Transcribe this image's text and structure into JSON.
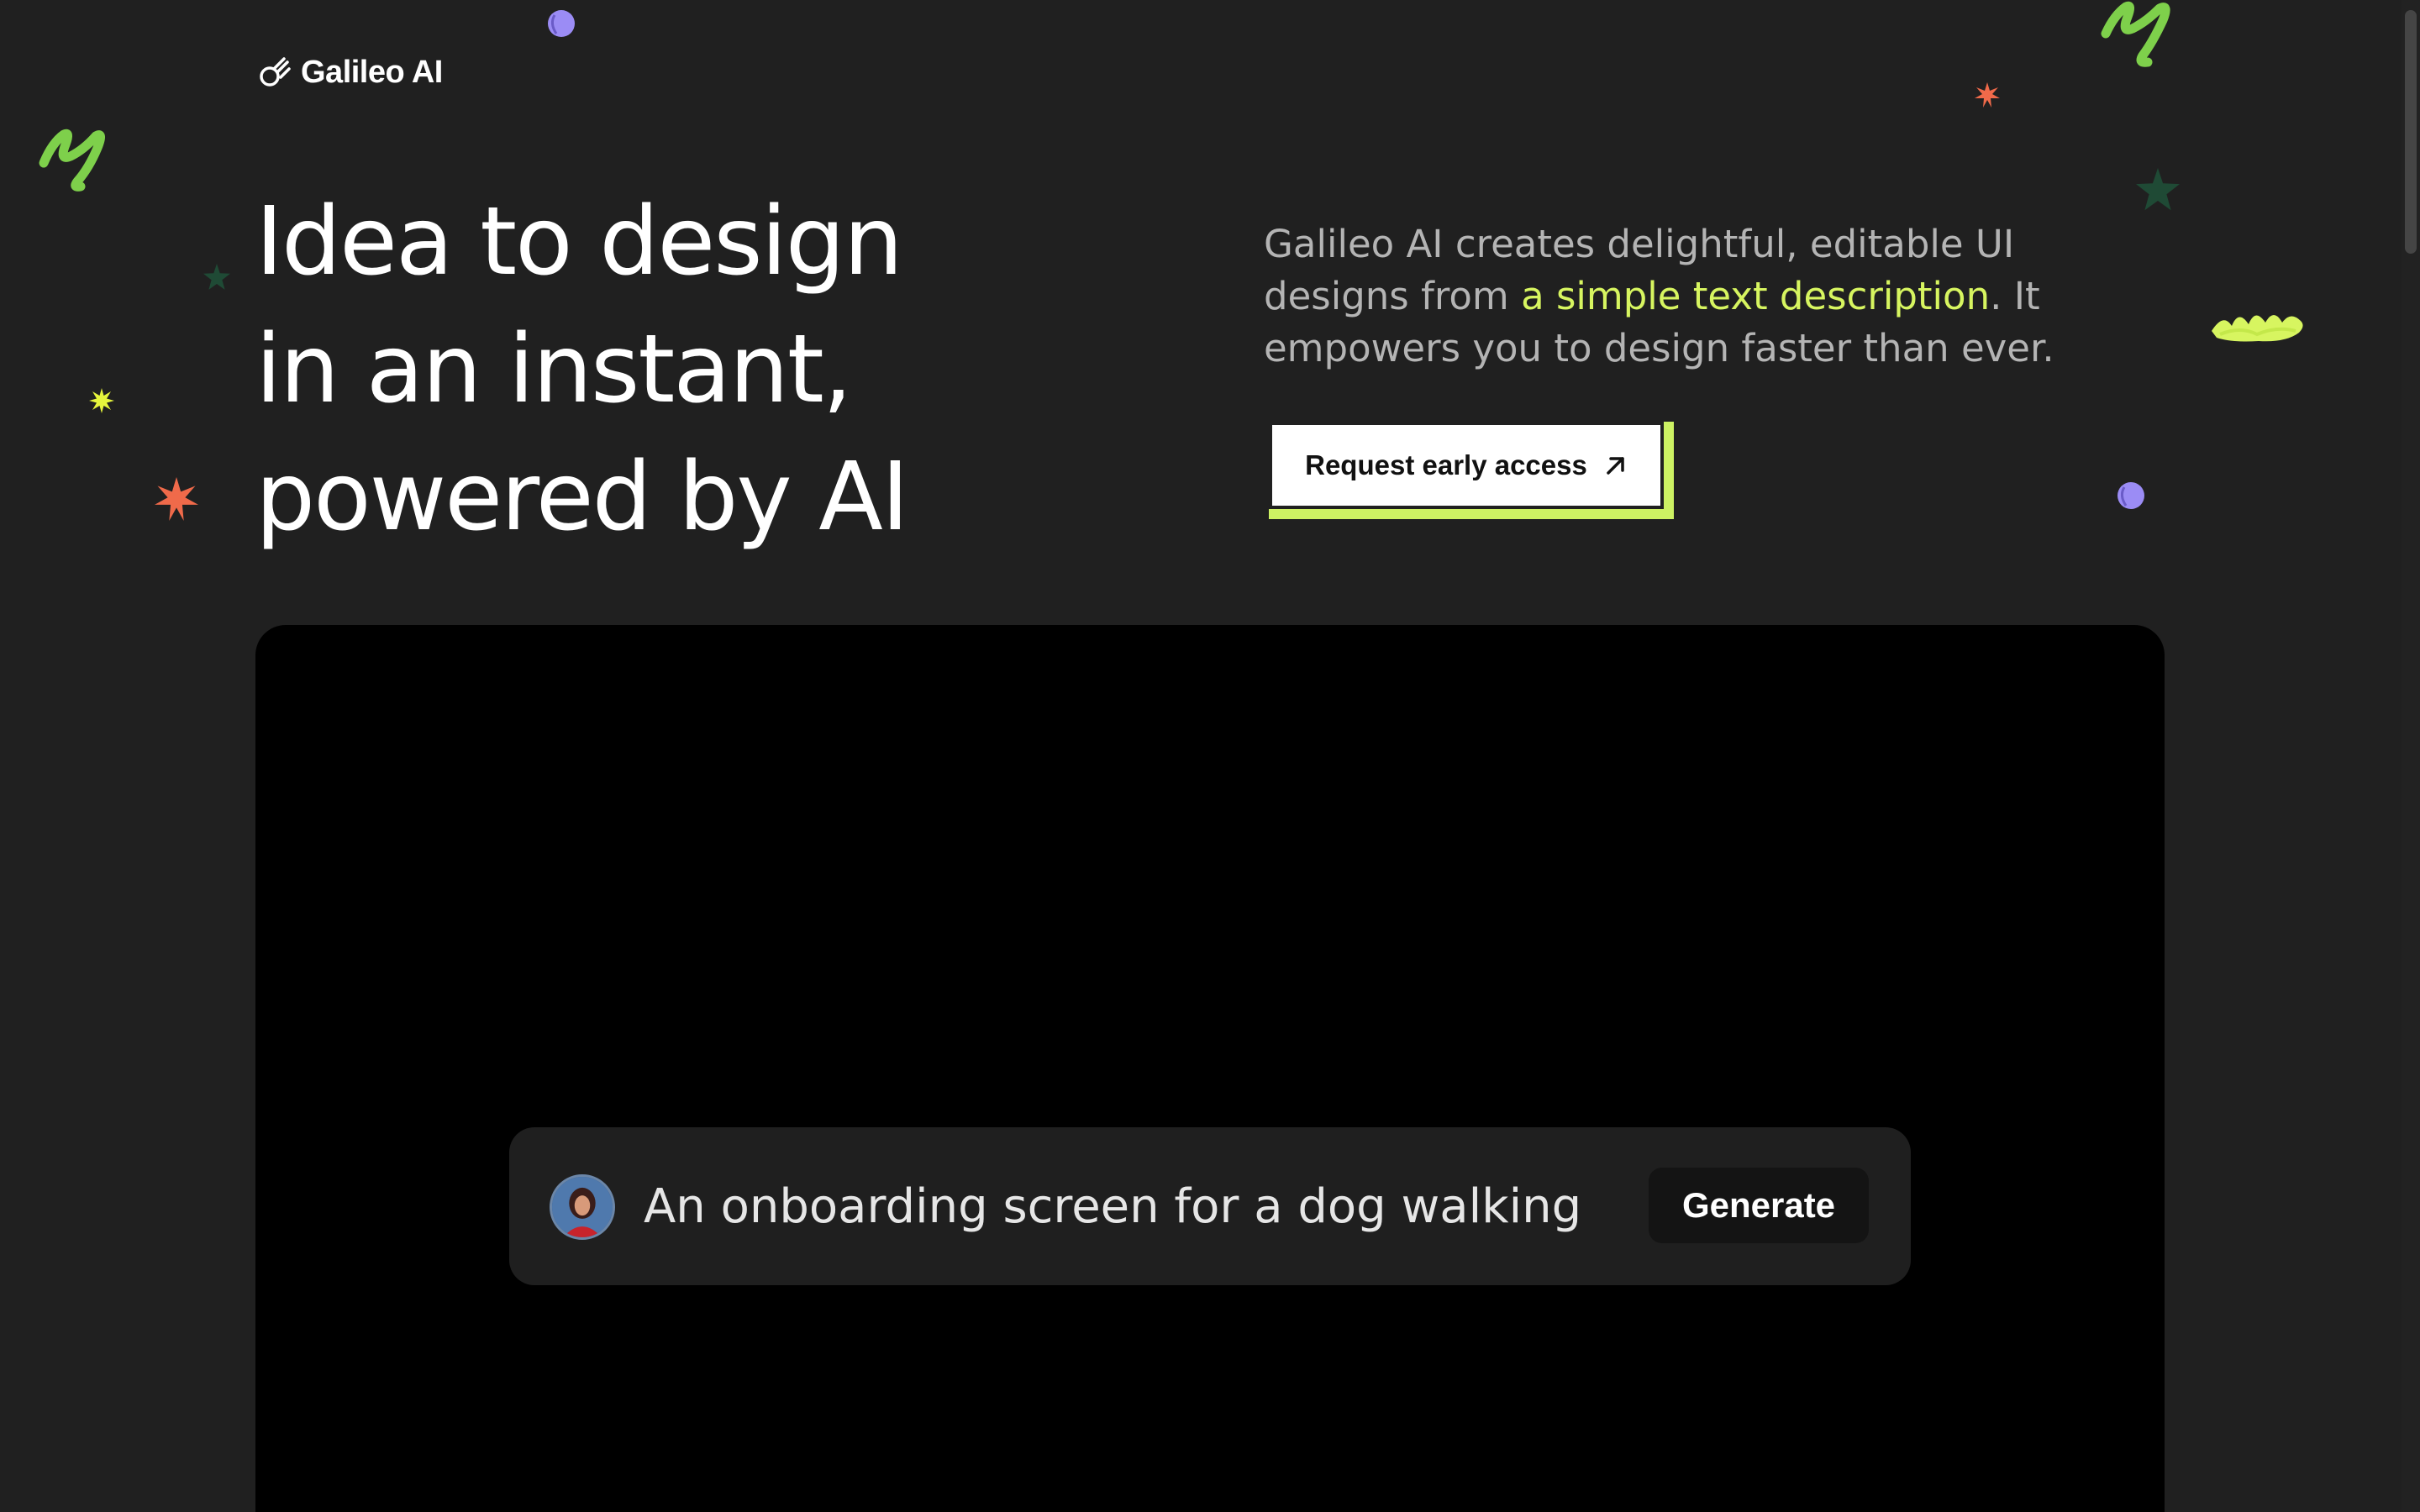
{
  "brand": {
    "name": "Galileo AI"
  },
  "hero": {
    "headline_lines": [
      "Idea to design",
      "in an instant,",
      "powered by AI"
    ],
    "description_before": "Galileo AI creates delightful, editable UI designs from ",
    "description_highlight": "a simple text description",
    "description_after": ". It empowers you to design faster than ever.",
    "cta_label": "Request early access",
    "cta_icon": "arrow-up-right-icon"
  },
  "demo": {
    "prompt_text": "An onboarding screen for a dog walking",
    "avatar_icon": "user-avatar",
    "generate_label": "Generate"
  },
  "colors": {
    "background": "#202020",
    "highlight": "#d7f560",
    "cta_shadow": "#cdf263",
    "deco_green": "#7ed04b",
    "deco_orange": "#f06a4a",
    "deco_purple": "#9b8cf5",
    "deco_dark_green": "#1f4a35",
    "deco_yellow": "#e6f53c"
  }
}
